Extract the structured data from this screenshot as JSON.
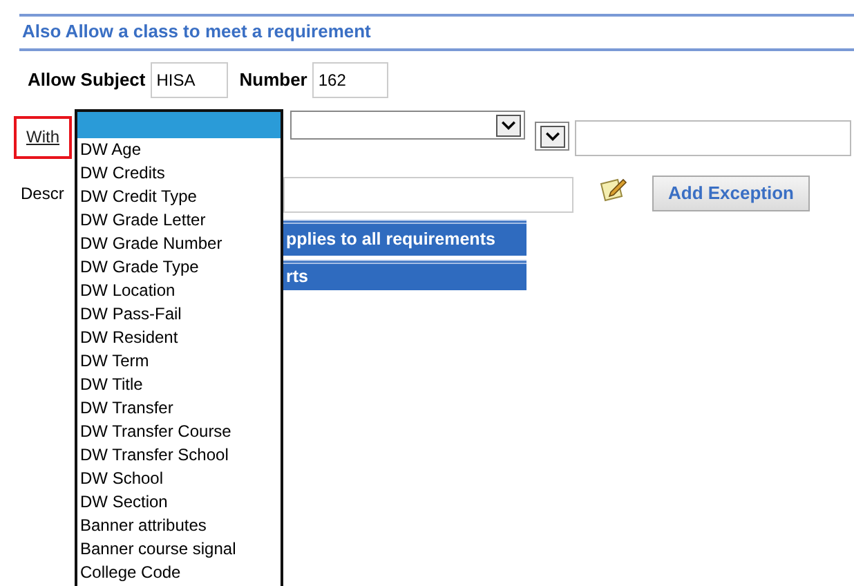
{
  "section_title": "Also Allow a class to meet a requirement",
  "subject": {
    "label": "Allow Subject",
    "value": "HISA"
  },
  "number": {
    "label": "Number",
    "value": "162"
  },
  "with_link": {
    "label": "With",
    "highlighted": true
  },
  "dropdown": {
    "blank_option": {
      "selected": true
    },
    "items": [
      {
        "label": "DW Age",
        "selected": false
      },
      {
        "label": "DW Credits",
        "selected": false
      },
      {
        "label": "DW Credit Type",
        "selected": false
      },
      {
        "label": "DW Grade Letter",
        "selected": false
      },
      {
        "label": "DW Grade Number",
        "selected": false
      },
      {
        "label": "DW Grade Type",
        "selected": false
      },
      {
        "label": "DW Location",
        "selected": false
      },
      {
        "label": "DW Pass-Fail",
        "selected": false
      },
      {
        "label": "DW Resident",
        "selected": false
      },
      {
        "label": "DW Term",
        "selected": false
      },
      {
        "label": "DW Title",
        "selected": false
      },
      {
        "label": "DW Transfer",
        "selected": false
      },
      {
        "label": "DW Transfer Course",
        "selected": false
      },
      {
        "label": "DW Transfer School",
        "selected": false
      },
      {
        "label": "DW School",
        "selected": false
      },
      {
        "label": "DW Section",
        "selected": false
      },
      {
        "label": "Banner attributes",
        "selected": false
      },
      {
        "label": "Banner course signal",
        "selected": false
      },
      {
        "label": "College Code",
        "selected": false
      }
    ]
  },
  "description": {
    "label": "Descr"
  },
  "add_button": "Add Exception",
  "bars": [
    "pplies to all requirements",
    "rts"
  ]
}
